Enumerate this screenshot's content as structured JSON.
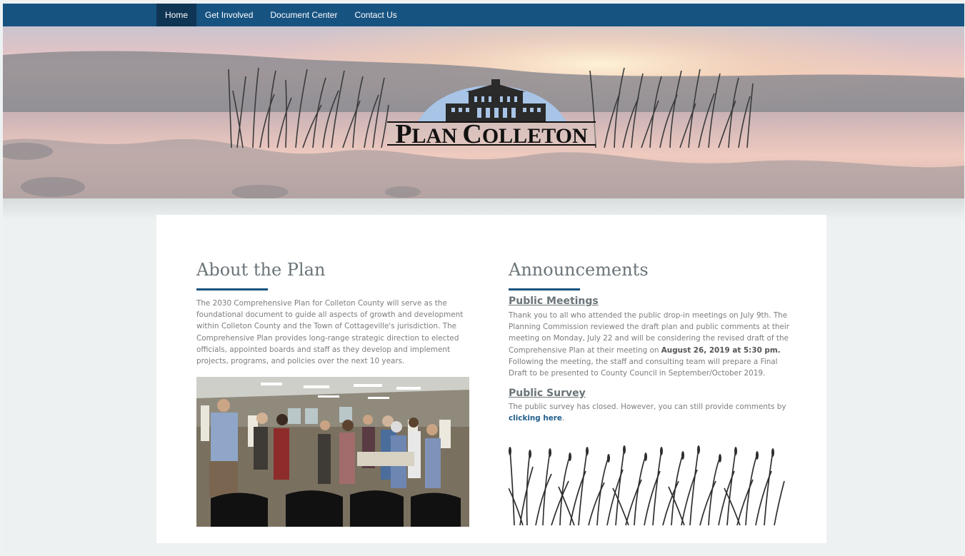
{
  "nav": {
    "items": [
      {
        "label": "Home",
        "active": true
      },
      {
        "label": "Get Involved",
        "active": false
      },
      {
        "label": "Document Center",
        "active": false
      },
      {
        "label": "Contact Us",
        "active": false
      }
    ]
  },
  "hero": {
    "logo_text": "PLAN COLLETON",
    "logo_text_first": "P",
    "logo_text_rest_1": "LAN ",
    "logo_text_second": "C",
    "logo_text_rest_2": "OLLETON"
  },
  "about": {
    "title": "About the Plan",
    "body": "The 2030 Comprehensive Plan for Colleton County will serve as the foundational document to guide all aspects of growth and development within Colleton County and the Town of Cottageville's jurisdiction. The Comprehensive Plan provides long-range strategic direction to elected officials, appointed boards and staff as they develop and implement projects, programs, and policies over the next 10 years."
  },
  "announcements": {
    "title": "Announcements",
    "meetings_heading": "Public Meetings",
    "meetings_text_1": "Thank you to all who attended the public drop-in meetings on July 9th.  The Planning Commission reviewed the draft plan and public comments at their meeting on Monday, July 22 and will be considering the revised draft of the Comprehensive Plan at their meeting on ",
    "meetings_bold": "August 26, 2019 at 5:30 pm.",
    "meetings_text_2": " Following the meeting, the staff and consulting team will prepare a Final Draft to be presented to County Council in September/October 2019.",
    "survey_heading": "Public Survey",
    "survey_text": "The public survey has closed. However, you can still provide comments by ",
    "survey_link": "clicking here",
    "survey_end": "."
  },
  "colors": {
    "nav_bg": "#175381",
    "nav_active": "#0f3555",
    "accent": "#175381",
    "page_bg": "#edf1f2"
  }
}
